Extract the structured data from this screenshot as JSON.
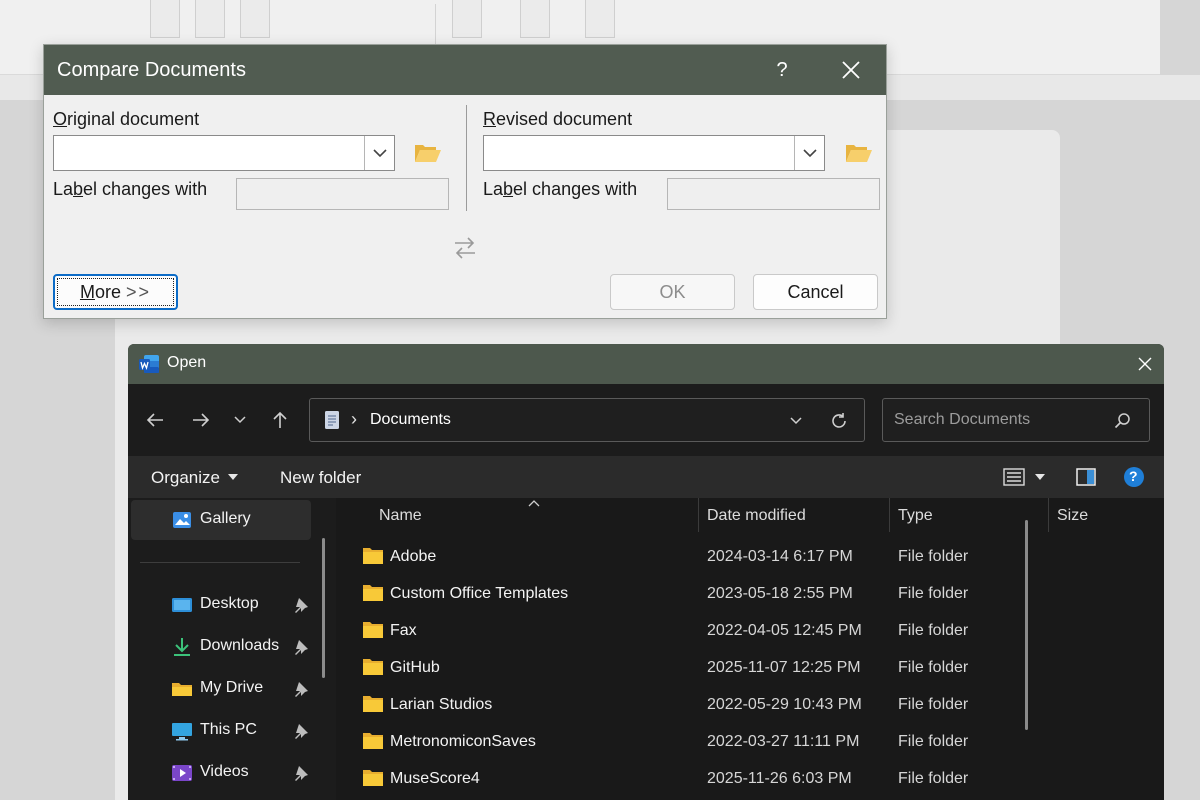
{
  "compare": {
    "title": "Compare Documents",
    "help": "?",
    "original_label_accel": "O",
    "original_label_rest": "riginal document",
    "revised_label_accel": "R",
    "revised_label_rest": "evised document",
    "label_changes_pre": "La",
    "label_changes_accel": "b",
    "label_changes_post": "el changes with",
    "label_changes2_pre": "La",
    "label_changes2_accel": "b",
    "label_changes2_post": "el changes with",
    "original_value": "",
    "revised_value": "",
    "label_original_value": "",
    "label_revised_value": "",
    "more_accel": "M",
    "more_rest": "ore",
    "more_arrows": ">>",
    "ok": "OK",
    "cancel": "Cancel"
  },
  "open": {
    "title": "Open",
    "breadcrumb_sep": "›",
    "location": "Documents",
    "search_placeholder": "Search Documents",
    "organize": "Organize",
    "new_folder": "New folder",
    "help": "?",
    "sidebar": [
      {
        "label": "Gallery",
        "icon": "gallery-icon",
        "pinned": false
      },
      {
        "label": "Desktop",
        "icon": "desktop-icon",
        "pinned": true
      },
      {
        "label": "Downloads",
        "icon": "download-icon",
        "pinned": true
      },
      {
        "label": "My Drive",
        "icon": "folder-icon",
        "pinned": true
      },
      {
        "label": "This PC",
        "icon": "pc-icon",
        "pinned": true
      },
      {
        "label": "Videos",
        "icon": "videos-icon",
        "pinned": true
      }
    ],
    "columns": [
      "Name",
      "Date modified",
      "Type",
      "Size"
    ],
    "files": [
      {
        "name": "Adobe",
        "date": "2024-03-14 6:17 PM",
        "type": "File folder"
      },
      {
        "name": "Custom Office Templates",
        "date": "2023-05-18 2:55 PM",
        "type": "File folder"
      },
      {
        "name": "Fax",
        "date": "2022-04-05 12:45 PM",
        "type": "File folder"
      },
      {
        "name": "GitHub",
        "date": "2025-11-07 12:25 PM",
        "type": "File folder"
      },
      {
        "name": "Larian Studios",
        "date": "2022-05-29 10:43 PM",
        "type": "File folder"
      },
      {
        "name": "MetronomiconSaves",
        "date": "2022-03-27 11:11 PM",
        "type": "File folder"
      },
      {
        "name": "MuseScore4",
        "date": "2025-11-26 6:03 PM",
        "type": "File folder"
      }
    ]
  },
  "colors": {
    "dialog_title_bar": "#515c51",
    "open_title_bar": "#4d584d",
    "accent_blue": "#0b6bc7",
    "folder_yellow": "#f8c938"
  }
}
